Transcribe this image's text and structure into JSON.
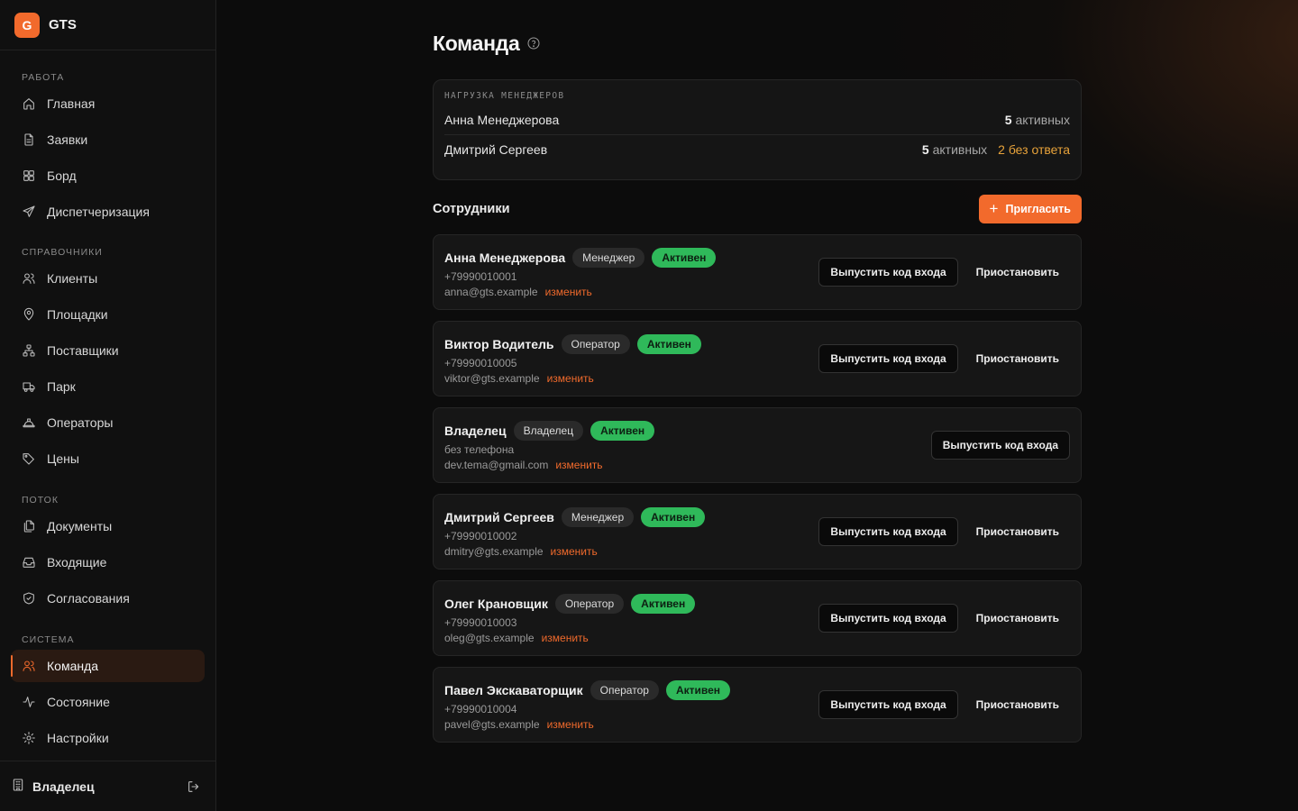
{
  "brand": {
    "logo_letter": "G",
    "name": "GTS",
    "accent": "#f26a2c"
  },
  "sidebar": {
    "sections": [
      {
        "title": "Работа",
        "items": [
          {
            "label": "Главная",
            "icon": "home-icon"
          },
          {
            "label": "Заявки",
            "icon": "document-icon"
          },
          {
            "label": "Борд",
            "icon": "grid-icon"
          },
          {
            "label": "Диспетчеризация",
            "icon": "send-icon"
          }
        ]
      },
      {
        "title": "Справочники",
        "items": [
          {
            "label": "Клиенты",
            "icon": "users-icon"
          },
          {
            "label": "Площадки",
            "icon": "map-pin-icon"
          },
          {
            "label": "Поставщики",
            "icon": "network-icon"
          },
          {
            "label": "Парк",
            "icon": "truck-icon"
          },
          {
            "label": "Операторы",
            "icon": "hard-hat-icon"
          },
          {
            "label": "Цены",
            "icon": "tag-icon"
          }
        ]
      },
      {
        "title": "Поток",
        "items": [
          {
            "label": "Документы",
            "icon": "files-icon"
          },
          {
            "label": "Входящие",
            "icon": "inbox-icon"
          },
          {
            "label": "Согласования",
            "icon": "shield-check-icon"
          }
        ]
      },
      {
        "title": "Система",
        "items": [
          {
            "label": "Команда",
            "icon": "users-icon",
            "active": true
          },
          {
            "label": "Состояние",
            "icon": "activity-icon"
          },
          {
            "label": "Настройки",
            "icon": "gear-icon"
          }
        ]
      }
    ],
    "footer": {
      "user": "Владелец",
      "icon": "building-icon",
      "logout_icon": "logout-icon"
    }
  },
  "page": {
    "title": "Команда",
    "help_icon": "help-circle-icon"
  },
  "load": {
    "title": "Нагрузка менеджеров",
    "rows": [
      {
        "name": "Анна Менеджерова",
        "active_count": "5",
        "active_label": "активных",
        "unanswered": ""
      },
      {
        "name": "Дмитрий Сергеев",
        "active_count": "5",
        "active_label": "активных",
        "unanswered": "2 без ответа"
      }
    ]
  },
  "staff": {
    "title": "Сотрудники",
    "invite_label": "Пригласить",
    "edit_label": "изменить",
    "issue_code_label": "Выпустить код входа",
    "suspend_label": "Приостановить",
    "members": [
      {
        "name": "Анна Менеджерова",
        "role": "Менеджер",
        "status": "Активен",
        "phone": "+79990010001",
        "email": "anna@gts.example",
        "can_suspend": true
      },
      {
        "name": "Виктор Водитель",
        "role": "Оператор",
        "status": "Активен",
        "phone": "+79990010005",
        "email": "viktor@gts.example",
        "can_suspend": true
      },
      {
        "name": "Владелец",
        "role": "Владелец",
        "status": "Активен",
        "phone": "без телефона",
        "email": "dev.tema@gmail.com",
        "can_suspend": false
      },
      {
        "name": "Дмитрий Сергеев",
        "role": "Менеджер",
        "status": "Активен",
        "phone": "+79990010002",
        "email": "dmitry@gts.example",
        "can_suspend": true
      },
      {
        "name": "Олег Крановщик",
        "role": "Оператор",
        "status": "Активен",
        "phone": "+79990010003",
        "email": "oleg@gts.example",
        "can_suspend": true
      },
      {
        "name": "Павел Экскаваторщик",
        "role": "Оператор",
        "status": "Активен",
        "phone": "+79990010004",
        "email": "pavel@gts.example",
        "can_suspend": true
      }
    ]
  },
  "colors": {
    "accent": "#f26a2c",
    "status_active": "#2fb95a",
    "warning": "#e7a23a",
    "background": "#0c0c0c"
  }
}
